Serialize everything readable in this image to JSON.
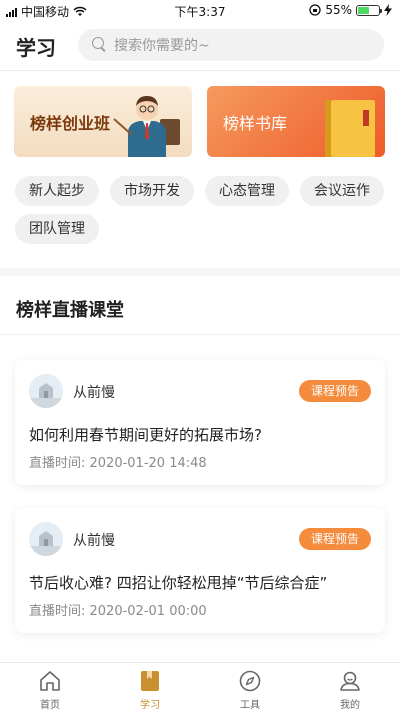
{
  "status_bar": {
    "carrier": "中国移动",
    "time": "下午3:37",
    "battery": "55%",
    "battery_level": 0.55
  },
  "header": {
    "title": "学习",
    "search_placeholder": "搜索你需要的~"
  },
  "banners": [
    {
      "label": "榜样创业班"
    },
    {
      "label": "榜样书库"
    }
  ],
  "tags": [
    "新人起步",
    "市场开发",
    "心态管理",
    "会议运作",
    "团队管理"
  ],
  "section": {
    "title": "榜样直播课堂"
  },
  "courses": [
    {
      "author": "从前慢",
      "badge": "课程预告",
      "title": "如何利用春节期间更好的拓展市场?",
      "time": "直播时间: 2020-01-20 14:48"
    },
    {
      "author": "从前慢",
      "badge": "课程预告",
      "title": "节后收心难? 四招让你轻松甩掉“节后综合症”",
      "time": "直播时间: 2020-02-01 00:00"
    }
  ],
  "tabbar": {
    "items": [
      {
        "label": "首页",
        "icon": "home-icon"
      },
      {
        "label": "学习",
        "icon": "book-icon",
        "active": true
      },
      {
        "label": "工具",
        "icon": "compass-icon"
      },
      {
        "label": "我的",
        "icon": "user-icon"
      }
    ]
  },
  "colors": {
    "accent": "#f58b3c",
    "active_tab": "#c9902f",
    "banner_orange": "#ef5a2a"
  }
}
